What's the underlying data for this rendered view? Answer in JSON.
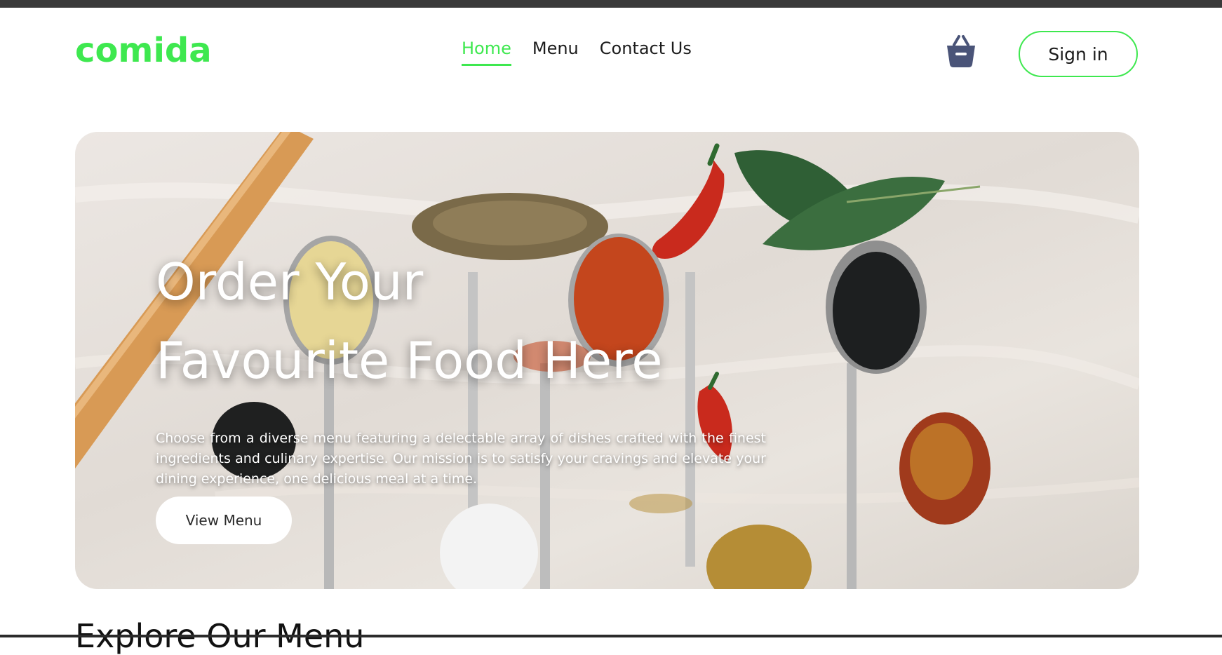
{
  "brand": {
    "name": "comida",
    "color": "#3ee84f"
  },
  "nav": {
    "items": [
      {
        "label": "Home",
        "active": true
      },
      {
        "label": "Menu",
        "active": false
      },
      {
        "label": "Contact Us",
        "active": false
      }
    ]
  },
  "header": {
    "cart_icon": "shopping-basket-icon",
    "signin_label": "Sign in"
  },
  "hero": {
    "title_line1": "Order Your",
    "title_line2": "Favourite Food Here",
    "description": "Choose from a diverse menu featuring a delectable array of dishes crafted with the finest ingredients and culinary expertise. Our mission is to satisfy your cravings and elevate your dining experience, one delicious meal at a time.",
    "cta_label": "View Menu"
  },
  "next_section": {
    "title_peek": "Explore Our Menu"
  }
}
